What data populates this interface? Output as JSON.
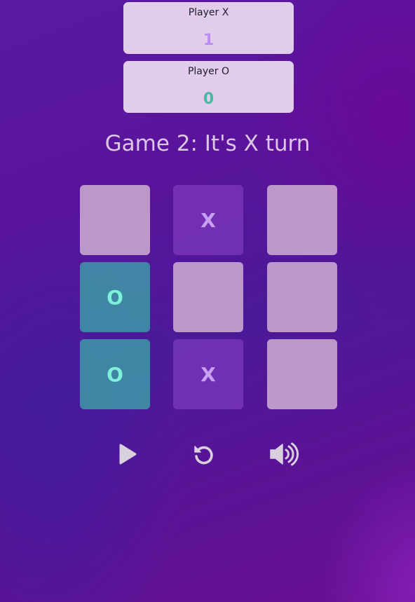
{
  "scoreboard": {
    "player_x": {
      "name": "Player X",
      "score": "1"
    },
    "player_o": {
      "name": "Player O",
      "score": "0"
    }
  },
  "status": "Game 2: It's X turn",
  "board": {
    "cells": [
      "",
      "X",
      "",
      "O",
      "",
      "",
      "O",
      "X",
      ""
    ]
  },
  "controls": {
    "play_icon": "play-icon",
    "restart_icon": "restart-icon",
    "sound_icon": "volume-icon"
  },
  "colors": {
    "x_mark": "#c7a0f2",
    "o_mark": "#7ef2d8",
    "icon": "#d8d0dc"
  }
}
